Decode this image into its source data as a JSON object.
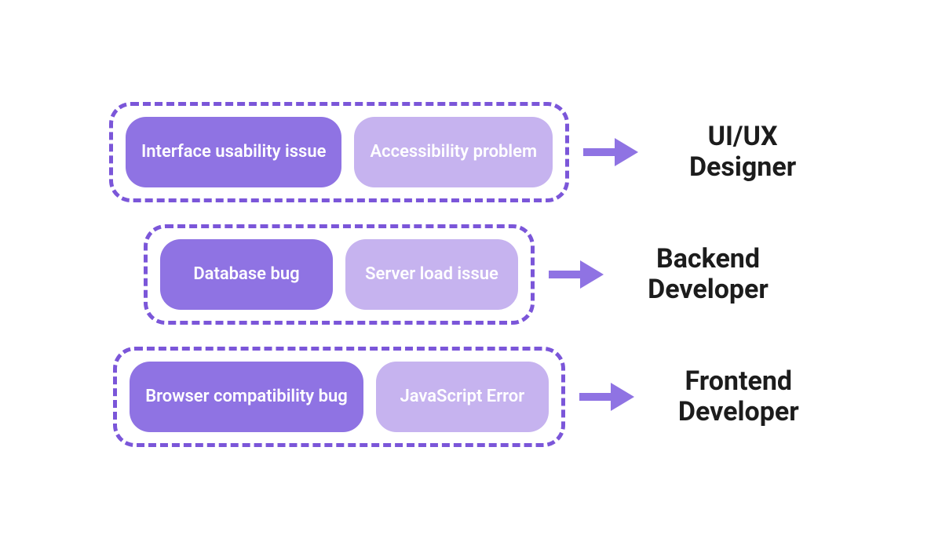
{
  "rows": [
    {
      "pills": [
        {
          "label": "Interface usability issue",
          "variant": "dark"
        },
        {
          "label": "Accessibility problem",
          "variant": "light"
        }
      ],
      "role": "UI/UX\nDesigner"
    },
    {
      "pills": [
        {
          "label": "Database bug",
          "variant": "dark"
        },
        {
          "label": "Server load issue",
          "variant": "light"
        }
      ],
      "role": "Backend\nDeveloper"
    },
    {
      "pills": [
        {
          "label": "Browser compatibility bug",
          "variant": "dark"
        },
        {
          "label": "JavaScript Error",
          "variant": "light"
        }
      ],
      "role": "Frontend\nDeveloper"
    }
  ],
  "colors": {
    "accent": "#7b56d9",
    "pillDark": "#8f73e3",
    "pillLight": "#c6b3ef",
    "text": "#1c1c1c"
  }
}
